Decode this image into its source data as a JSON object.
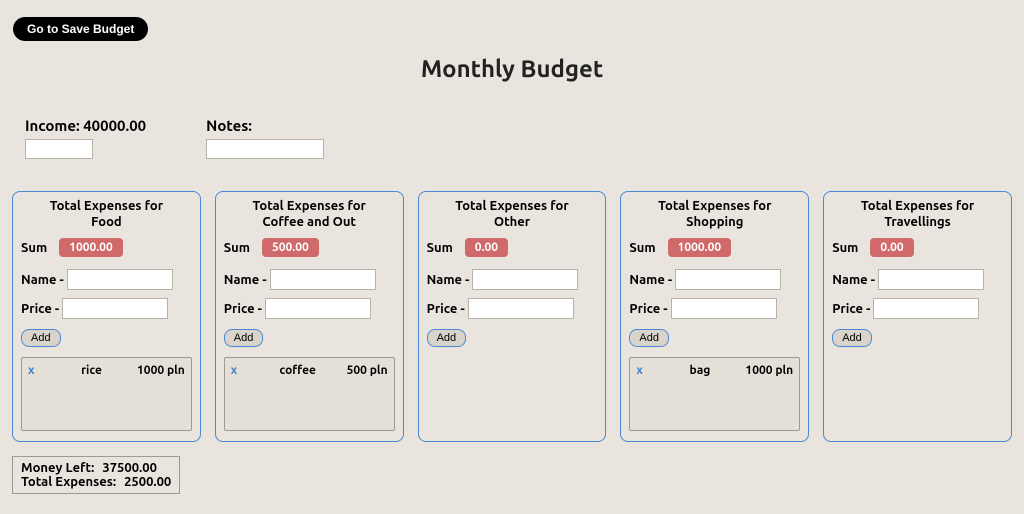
{
  "top_button": "Go to Save Budget",
  "title": "Monthly Budget",
  "income_label": "Income: 40000.00",
  "notes_label": "Notes:",
  "add_label": "Add",
  "name_label": "Name -",
  "price_label": "Price -",
  "sum_label": "Sum",
  "cards": [
    {
      "title_l1": "Total Expenses for",
      "title_l2": "Food",
      "sum": "1000.00",
      "items": [
        {
          "name": "rice",
          "price": "1000 pln"
        }
      ]
    },
    {
      "title_l1": "Total Expenses for",
      "title_l2": "Coffee and Out",
      "sum": "500.00",
      "items": [
        {
          "name": "coffee",
          "price": "500 pln"
        }
      ]
    },
    {
      "title_l1": "Total Expenses for",
      "title_l2": "Other",
      "sum": "0.00",
      "items": []
    },
    {
      "title_l1": "Total Expenses for",
      "title_l2": "Shopping",
      "sum": "1000.00",
      "items": [
        {
          "name": "bag",
          "price": "1000 pln"
        }
      ]
    },
    {
      "title_l1": "Total Expenses for",
      "title_l2": "Travellings",
      "sum": "0.00",
      "items": []
    }
  ],
  "summary": {
    "money_left_label": "Money Left:",
    "money_left_value": "37500.00",
    "total_expenses_label": "Total Expenses:",
    "total_expenses_value": "2500.00"
  }
}
